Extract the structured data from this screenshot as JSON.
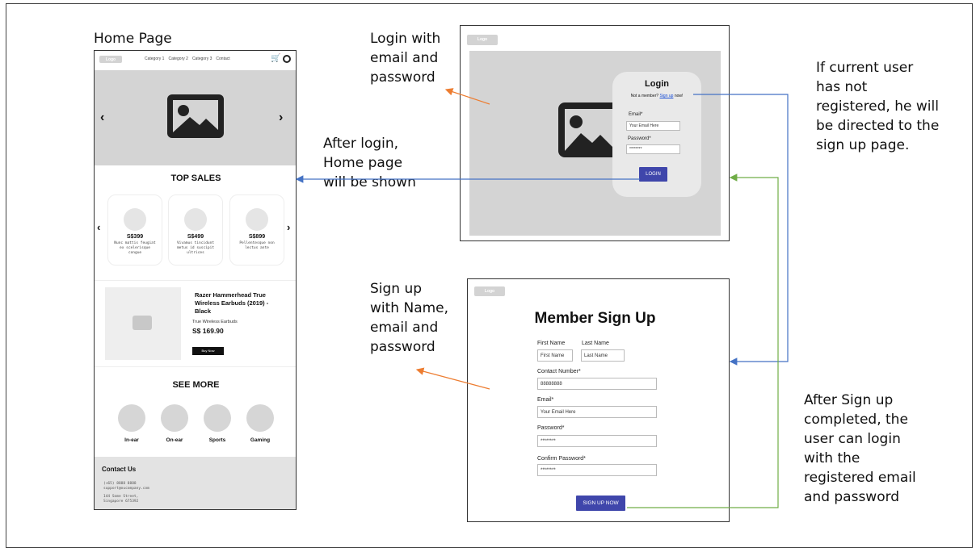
{
  "home": {
    "caption": "Home Page",
    "logo": "Logo",
    "nav": [
      "Category 1",
      "Category 2",
      "Category 3",
      "Contact"
    ],
    "top_sales_title": "TOP SALES",
    "products": [
      {
        "price": "S$399",
        "desc": "Nunc mattis feugiat ex scelerisque congue"
      },
      {
        "price": "S$499",
        "desc": "Vivamus tincidunt metus id suscipit ultrices"
      },
      {
        "price": "S$899",
        "desc": "Pellentesque non lectus ante"
      }
    ],
    "featured": {
      "name": "Razer Hammerhead True Wireless Earbuds (2019) - Black",
      "sub": "True Wireless Earbuds",
      "price": "S$ 169.90",
      "button": "Buy Now"
    },
    "see_more_title": "SEE MORE",
    "categories": [
      "In-ear",
      "On-ear",
      "Sports",
      "Gaming"
    ],
    "contact_title": "Contact Us",
    "contact_lines": [
      "(+65) 8888 8888",
      "support@oucompany.com",
      "144 Some Street,",
      "Singapore 675392"
    ]
  },
  "login": {
    "logo": "Logo",
    "title": "Login",
    "not_member_pre": "Not a member? ",
    "signup_link": "Sign up",
    "not_member_post": " now!",
    "email_label": "Email*",
    "email_placeholder": "Your Email Here",
    "password_label": "Password*",
    "password_value": "********",
    "button": "LOGIN"
  },
  "signup": {
    "logo": "Logo",
    "title": "Member Sign Up",
    "first_name_label": "First Name",
    "first_name_placeholder": "First Name",
    "last_name_label": "Last Name",
    "last_name_placeholder": "Last Name",
    "contact_label": "Contact Number*",
    "contact_value": "88888888",
    "email_label": "Email*",
    "email_placeholder": "Your Email Here",
    "password_label": "Password*",
    "password_value": "********",
    "confirm_label": "Confirm Password*",
    "confirm_value": "********",
    "button": "SIGN UP NOW"
  },
  "annotations": {
    "login_with": [
      "Login with",
      "email and",
      "password"
    ],
    "after_login": [
      "After login,",
      "Home page",
      "will be shown"
    ],
    "signup_with": [
      "Sign up",
      "with Name,",
      "email and",
      "password"
    ],
    "not_registered": [
      "If current user",
      "has not",
      "registered, he will",
      "be directed to the",
      "sign up page."
    ],
    "after_signup": [
      "After Sign up",
      "completed, the",
      "user can login",
      "with the",
      "registered email",
      "and password"
    ]
  },
  "colors": {
    "blue_arrow": "#4472c4",
    "orange_arrow": "#ed7d31",
    "green_arrow": "#70ad47",
    "button_blue": "#3f46ab"
  }
}
